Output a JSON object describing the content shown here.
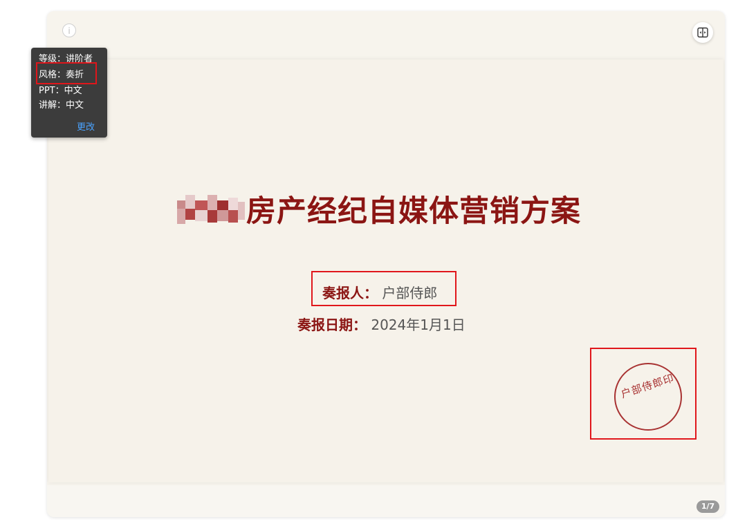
{
  "tooltip": {
    "level_label": "等级：",
    "level_value": "讲阶者",
    "style_label": "风格：",
    "style_value": "奏折",
    "ppt_label": "PPT：",
    "ppt_value": "中文",
    "explain_label": "讲解：",
    "explain_value": "中文",
    "change_label": "更改"
  },
  "slide": {
    "title_visible": "房产经纪自媒体营销方案",
    "reporter_label": "奏报人：",
    "reporter_value": "户部侍郎",
    "date_label": "奏报日期：",
    "date_value": "2024年1月1日",
    "seal_text": "户部侍郎印"
  },
  "pagination": {
    "current": "1",
    "separator": "/",
    "total": "7"
  },
  "icons": {
    "info": "info-icon",
    "compare": "split-view-icon"
  },
  "colors": {
    "title_red": "#8b1513",
    "highlight_red": "#e0161b",
    "seal_red": "#a83232",
    "tooltip_bg": "#3c3c3c",
    "link_blue": "#4aa3ff",
    "slide_bg": "#f6f2ea"
  }
}
